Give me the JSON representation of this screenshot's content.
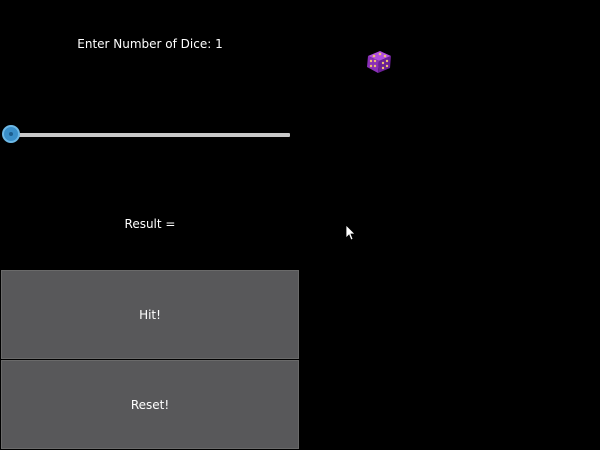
{
  "labels": {
    "prompt": "Enter Number of Dice: 1",
    "result": "Result ="
  },
  "slider": {
    "value": 1,
    "fraction": 0.0
  },
  "buttons": {
    "hit": "Hit!",
    "reset": "Reset!"
  },
  "icons": {
    "dice": "dice-icon",
    "cursor": "mouse-cursor-icon"
  },
  "colors": {
    "background": "#000000",
    "button": "#58585a",
    "slider_track": "#c9c9c9",
    "slider_handle": "#3a8fc9",
    "dice": "#8a2fb8"
  }
}
